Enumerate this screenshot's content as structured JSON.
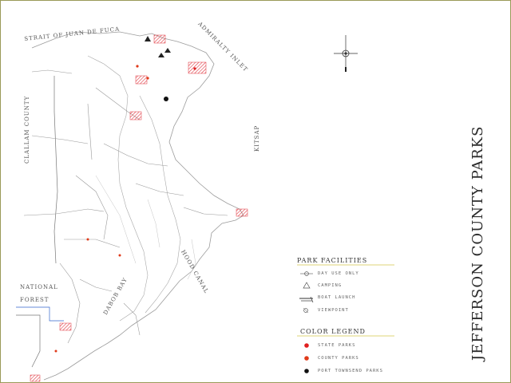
{
  "map": {
    "title": "JEFFERSON COUNTY PARKS",
    "colors": {
      "frame": "#9a9a58",
      "park_hatch": "#e0363f",
      "state_park": "#e02020",
      "county_park": "#e03a1a",
      "port_townsend_park": "#111111",
      "roads": "#9a9a9a",
      "legend_underline": "#d4c84a"
    },
    "area_labels": {
      "strait": "STRAIT OF JUAN DE FUCA",
      "admiralty": "ADMIRALTY INLET",
      "clallam": "CLALLAM COUNTY",
      "hood_canal": "HOOD CANAL",
      "national_forest": "NATIONAL FOREST",
      "dabob": "DABOB BAY",
      "kitsap": "KITSAP"
    },
    "icons": [
      "compass-rose-icon",
      "day-use-icon",
      "camping-icon",
      "boat-launch-icon",
      "viewpoint-icon"
    ],
    "legend": {
      "facilities_heading": "PARK FACILITIES",
      "facilities": [
        "DAY USE ONLY",
        "CAMPING",
        "BOAT LAUNCH",
        "VIEWPOINT"
      ],
      "color_heading": "COLOR LEGEND",
      "colors": [
        "STATE PARKS",
        "COUNTY PARKS",
        "PORT TOWNSEND PARKS"
      ]
    }
  }
}
